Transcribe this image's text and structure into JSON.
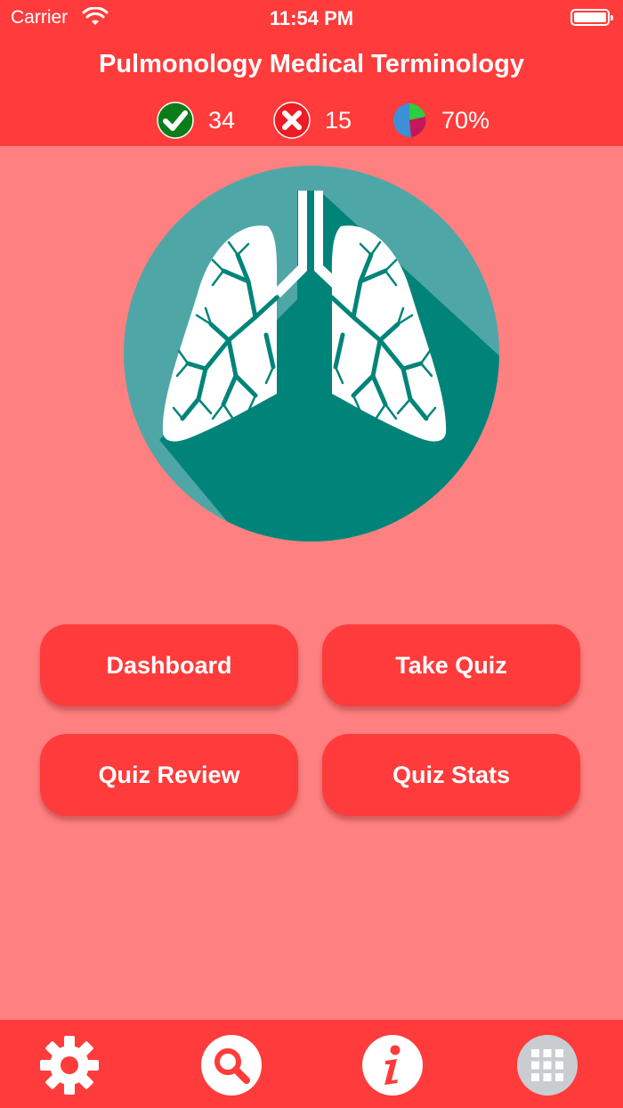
{
  "status_bar": {
    "carrier": "Carrier",
    "time": "11:54 PM"
  },
  "header": {
    "title": "Pulmonology Medical Terminology",
    "correct_count": "34",
    "wrong_count": "15",
    "score_percent": "70%"
  },
  "hero": {
    "icon": "lungs-icon"
  },
  "menu": {
    "dashboard": "Dashboard",
    "take_quiz": "Take Quiz",
    "quiz_review": "Quiz Review",
    "quiz_stats": "Quiz Stats"
  },
  "tabbar": {
    "icons": [
      "gear-icon",
      "search-icon",
      "info-icon",
      "grid-icon"
    ]
  },
  "colors": {
    "header_bg": "#ff3b3b",
    "page_bg": "#ff8080",
    "hero_circle": "#4fa6a6",
    "hero_shadow": "#00847a",
    "correct_green": "#0a7d1a",
    "wrong_red": "#ee1c24"
  }
}
